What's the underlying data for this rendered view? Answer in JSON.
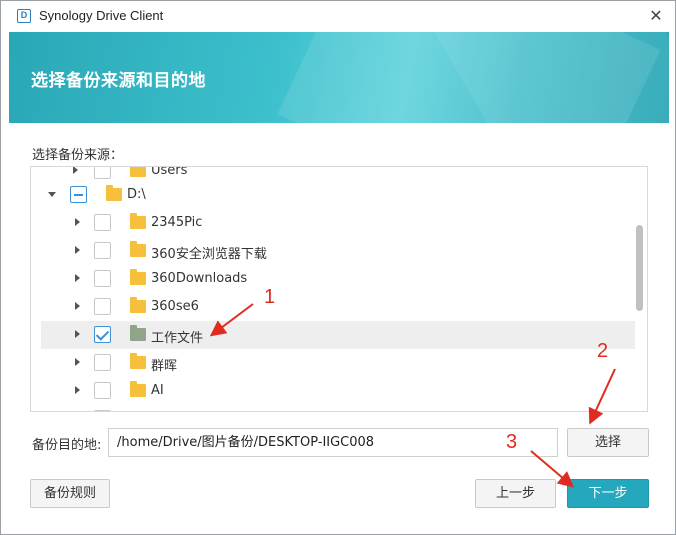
{
  "window": {
    "title": "Synology Drive Client",
    "icon": "synology-drive-icon",
    "close_glyph": "✕"
  },
  "banner": {
    "title": "选择备份来源和目的地"
  },
  "source": {
    "label": "选择备份来源："
  },
  "tree": {
    "rows": [
      {
        "label": "Users",
        "checked": "none",
        "expanded": false
      },
      {
        "label": "D:\\",
        "checked": "partial",
        "expanded": true
      },
      {
        "label": "2345Pic",
        "checked": "none"
      },
      {
        "label": "360安全浏览器下载",
        "checked": "none"
      },
      {
        "label": "360Downloads",
        "checked": "none"
      },
      {
        "label": "360se6",
        "checked": "none"
      },
      {
        "label": "工作文件",
        "checked": "checked",
        "selected": true
      },
      {
        "label": "群晖",
        "checked": "none"
      },
      {
        "label": "AI",
        "checked": "none"
      }
    ]
  },
  "destination": {
    "label": "备份目的地:",
    "value": "/home/Drive/图片备份/DESKTOP-IIGC008",
    "select_button": "选择"
  },
  "footer": {
    "rules_button": "备份规则",
    "prev_button": "上一步",
    "next_button": "下一步"
  },
  "annotations": {
    "n1": "1",
    "n2": "2",
    "n3": "3",
    "color": "#e02b20"
  },
  "colors": {
    "accent": "#25a7bd",
    "checkbox": "#3d8fd6"
  }
}
